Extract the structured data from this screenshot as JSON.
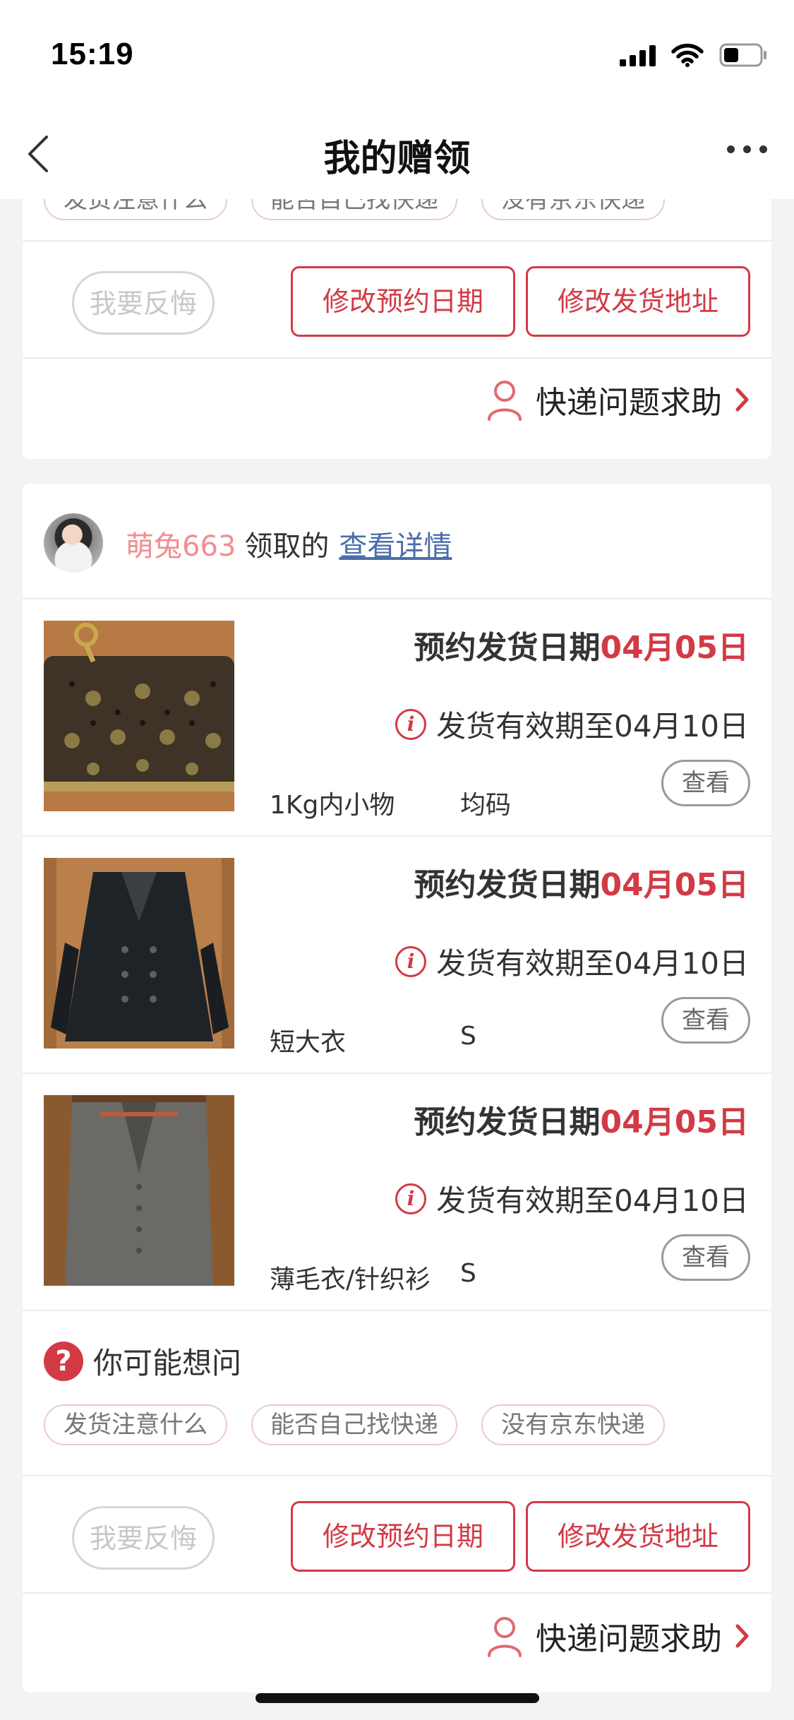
{
  "status": {
    "time": "15:19"
  },
  "nav": {
    "title": "我的赠领"
  },
  "faq": {
    "title": "你可能想问",
    "chips": [
      "发货注意什么",
      "能否自己找快递",
      "没有京东快递"
    ]
  },
  "actions": {
    "regret": "我要反悔",
    "modify_date": "修改预约日期",
    "modify_address": "修改发货地址"
  },
  "help": {
    "label": "快递问题求助"
  },
  "receiver": {
    "name": "萌兔663",
    "suffix": "领取的",
    "link": "查看详情"
  },
  "items": [
    {
      "appt_label": "预约发货日期",
      "appt_date": "04月05日",
      "valid_text": "发货有效期至04月10日",
      "category": "1Kg内小物",
      "size": "均码",
      "view": "查看"
    },
    {
      "appt_label": "预约发货日期",
      "appt_date": "04月05日",
      "valid_text": "发货有效期至04月10日",
      "category": "短大衣",
      "size": "S",
      "view": "查看"
    },
    {
      "appt_label": "预约发货日期",
      "appt_date": "04月05日",
      "valid_text": "发货有效期至04月10日",
      "category": "薄毛衣/针织衫",
      "size": "S",
      "view": "查看"
    }
  ],
  "colors": {
    "accent": "#d23a45",
    "receiver_name": "#f08e90",
    "link": "#4a6ea9"
  },
  "icons": [
    "back-chevron-icon",
    "more-dots-icon",
    "person-icon",
    "chevron-right-icon",
    "info-icon",
    "question-icon"
  ]
}
